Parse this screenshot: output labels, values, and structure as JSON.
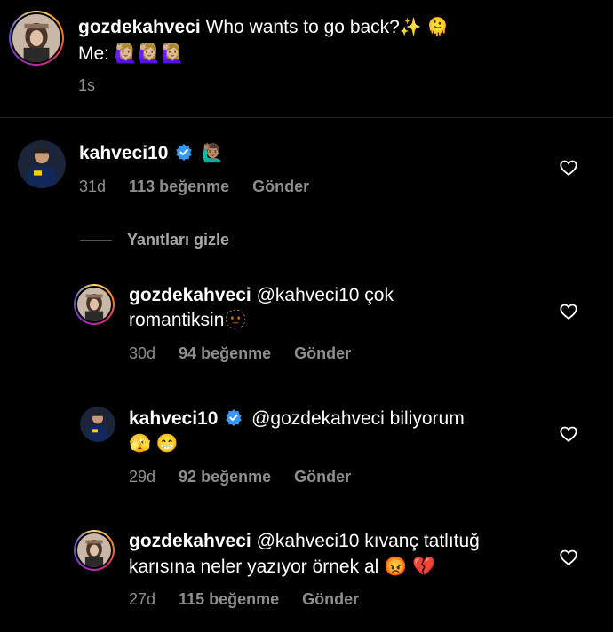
{
  "caption": {
    "username": "gozdekahveci",
    "line1": "Who wants to go back?",
    "line1_emoji": "✨ 🫠",
    "line2": "Me: 🙋🏼‍♀️🙋🏼‍♀️🙋🏼‍♀️",
    "time": "1s"
  },
  "comments": [
    {
      "username": "kahveci10",
      "verified": true,
      "text": "🙋🏽‍♂️",
      "time": "31d",
      "likes": "113 beğenme",
      "reply": "Gönder"
    }
  ],
  "hide_replies": "Yanıtları gizle",
  "replies": [
    {
      "username": "gozdekahveci",
      "text1": "@kahveci10 çok",
      "text2": "romantiksin🫥",
      "time": "30d",
      "likes": "94 beğenme",
      "reply": "Gönder"
    },
    {
      "username": "kahveci10",
      "verified": true,
      "text1": "@gozdekahveci biliyorum",
      "text2": "🫣 😁",
      "time": "29d",
      "likes": "92 beğenme",
      "reply": "Gönder"
    },
    {
      "username": "gozdekahveci",
      "text1": "@kahveci10 kıvanç tatlıtuğ",
      "text2": "karısına neler yazıyor örnek al 😡 💔",
      "time": "27d",
      "likes": "115 beğenme",
      "reply": "Gönder"
    }
  ],
  "colors": {
    "verified": "#3897f0",
    "muted": "#8e8e8e"
  },
  "icons": [
    "heart-icon",
    "verified-badge-icon"
  ]
}
